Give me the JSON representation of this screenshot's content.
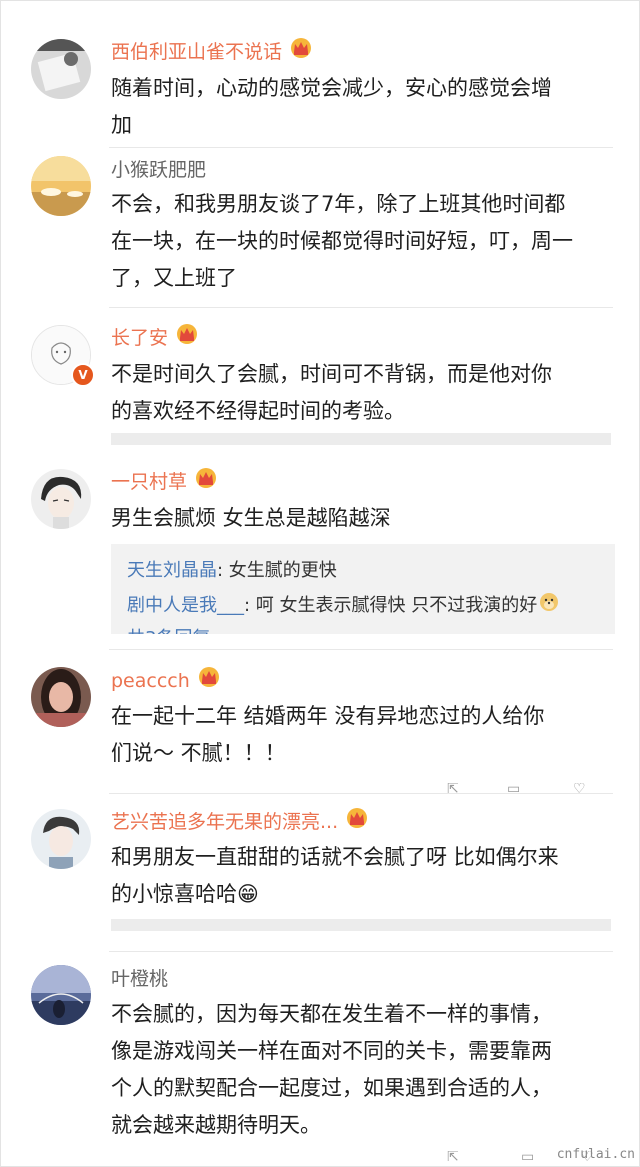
{
  "comments": [
    {
      "name": "西伯利亚山雀不说话",
      "name_style": "orange",
      "lines": [
        "随着时间，心动的感觉会减少，安心的感觉会增",
        "加"
      ],
      "vip": true,
      "verified": false
    },
    {
      "name": "小猴跃肥肥",
      "name_style": "gray",
      "lines": [
        "不会，和我男朋友谈了7年，除了上班其他时间都",
        "在一块，在一块的时候都觉得时间好短，叮，周一",
        "了，又上班了"
      ],
      "vip": false,
      "verified": false
    },
    {
      "name": "长了安",
      "name_style": "orange",
      "lines": [
        "不是时间久了会腻，时间可不背锅，而是他对你",
        "的喜欢经不经得起时间的考验。"
      ],
      "vip": true,
      "verified": true
    },
    {
      "name": "一只村草",
      "name_style": "orange",
      "lines": [
        "男生会腻烦 女生总是越陷越深"
      ],
      "vip": true,
      "verified": false,
      "replies": [
        {
          "user": "天生刘晶晶",
          "text": ": 女生腻的更快",
          "emoji": ""
        },
        {
          "user": "剧中人是我___",
          "text": ": 呵 女生表示腻得快 只不过我演的好",
          "emoji": "doge-emoji"
        }
      ]
    },
    {
      "name": "peaccch",
      "name_style": "orange",
      "lines": [
        "在一起十二年 结婚两年 没有异地恋过的人给你",
        "们说～ 不腻！！！"
      ],
      "vip": true,
      "verified": false
    },
    {
      "name": "艺兴苦追多年无果的漂亮...",
      "name_style": "orange",
      "lines": [
        "和男朋友一直甜甜的话就不会腻了呀 比如偶尔来",
        "的小惊喜哈哈😁"
      ],
      "vip": true,
      "verified": false
    },
    {
      "name": "叶橙桃",
      "name_style": "gray",
      "lines": [
        "不会腻的，因为每天都在发生着不一样的事情，",
        "像是游戏闯关一样在面对不同的关卡，需要靠两",
        "个人的默契配合一起度过，如果遇到合适的人，",
        "就会越来越期待明天。"
      ],
      "vip": false,
      "verified": false
    }
  ],
  "colors": {
    "accent_orange": "#eb7350",
    "reply_blue": "#4a7ab8",
    "verified_orange": "#e5571d"
  },
  "watermark": "cnfulai.cn"
}
